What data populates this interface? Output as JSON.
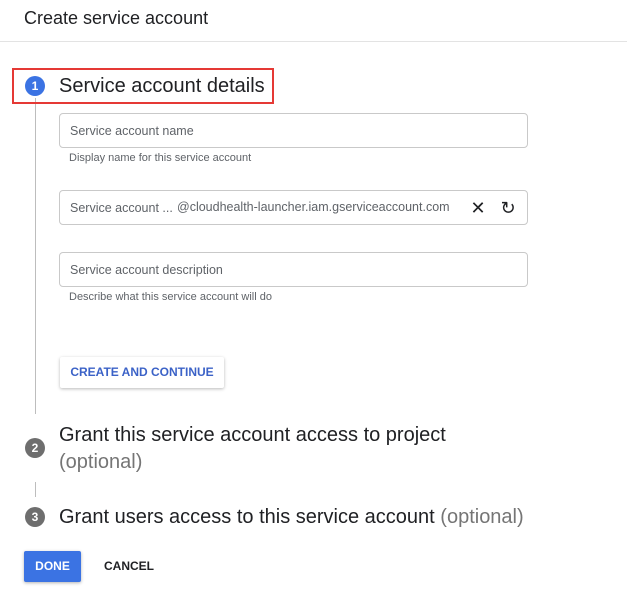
{
  "header": {
    "title": "Create service account"
  },
  "colors": {
    "accent": "#3b73e3",
    "highlight": "#e53935",
    "inactive_step": "#6e6e6e"
  },
  "steps": [
    {
      "number": "1",
      "title": "Service account details",
      "optional": "",
      "state": "active"
    },
    {
      "number": "2",
      "title": "Grant this service account access to project",
      "optional": "(optional)",
      "state": "inactive"
    },
    {
      "number": "3",
      "title": "Grant users access to this service account",
      "optional": "(optional)",
      "state": "inactive"
    }
  ],
  "form": {
    "name": {
      "placeholder": "Service account name",
      "value": "",
      "helper": "Display name for this service account"
    },
    "id": {
      "placeholder": "Service account ...",
      "value": "",
      "suffix": "@cloudhealth-launcher.iam.gserviceaccount.com",
      "clear_icon": "close-icon",
      "refresh_icon": "refresh-icon"
    },
    "description": {
      "placeholder": "Service account description",
      "value": "",
      "helper": "Describe what this service account will do"
    },
    "create_button": "CREATE AND CONTINUE"
  },
  "footer": {
    "done": "DONE",
    "cancel": "CANCEL"
  }
}
